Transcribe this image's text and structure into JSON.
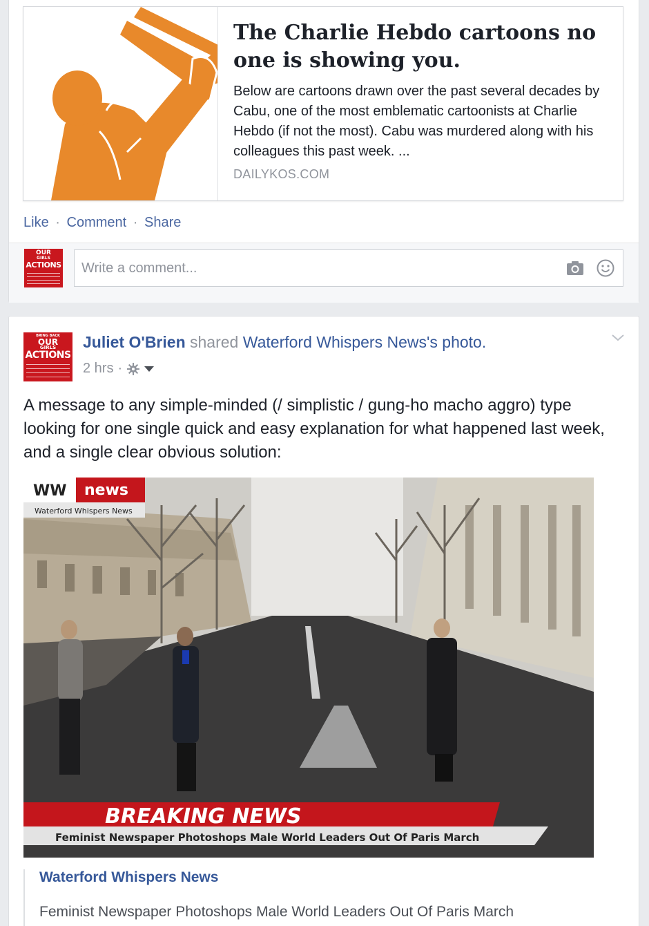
{
  "post1": {
    "link_preview": {
      "title": "The Charlie Hebdo cartoons no one is showing you.",
      "description": "Below are cartoons drawn over the past several decades by Cabu, one of the most emblematic cartoonists at Charlie Hebdo (if not the most). Cabu was murdered along with his colleagues this past week. ...",
      "domain": "DAILYKOS.COM",
      "thumbnail_icon": "orange-figure-illustration"
    },
    "actions": {
      "like": "Like",
      "comment": "Comment",
      "share": "Share",
      "separator": "·"
    },
    "comment_box": {
      "placeholder": "Write a comment...",
      "avatar_text_top": "OUR",
      "avatar_text_mid": "GIRLS",
      "avatar_text_main": "ACTIONS"
    }
  },
  "post2": {
    "author": "Juliet O'Brien",
    "verb": "shared",
    "shared_source": "Waterford Whispers News",
    "shared_suffix": "'s photo.",
    "time": "2 hrs",
    "dot": "·",
    "body": "A message to any simple-minded (/ simplistic / gung-ho macho aggro) type looking for one single quick and easy explanation for what happened last week, and a single clear obvious solution:",
    "avatar_text_small": "BRING BACK",
    "avatar_text_top": "OUR",
    "avatar_text_mid": "GIRLS",
    "avatar_text_main": "ACTIONS",
    "photo": {
      "logo_ww": "WW",
      "logo_news": "news",
      "logo_sub": "Waterford Whispers News",
      "breaking": "BREAKING NEWS",
      "ticker": "Feminist Newspaper Photoshops Male World Leaders Out Of Paris March",
      "road_letter": "A"
    },
    "attachment": {
      "source_name": "Waterford Whispers News",
      "headline": "Feminist Newspaper Photoshops Male World Leaders Out Of Paris March"
    }
  },
  "colors": {
    "link_blue": "#365899",
    "action_blue": "#4b67a1",
    "muted_gray": "#90949c",
    "avatar_red": "#c9171e",
    "thumb_orange": "#e8892b",
    "breaking_red": "#c4161c"
  }
}
